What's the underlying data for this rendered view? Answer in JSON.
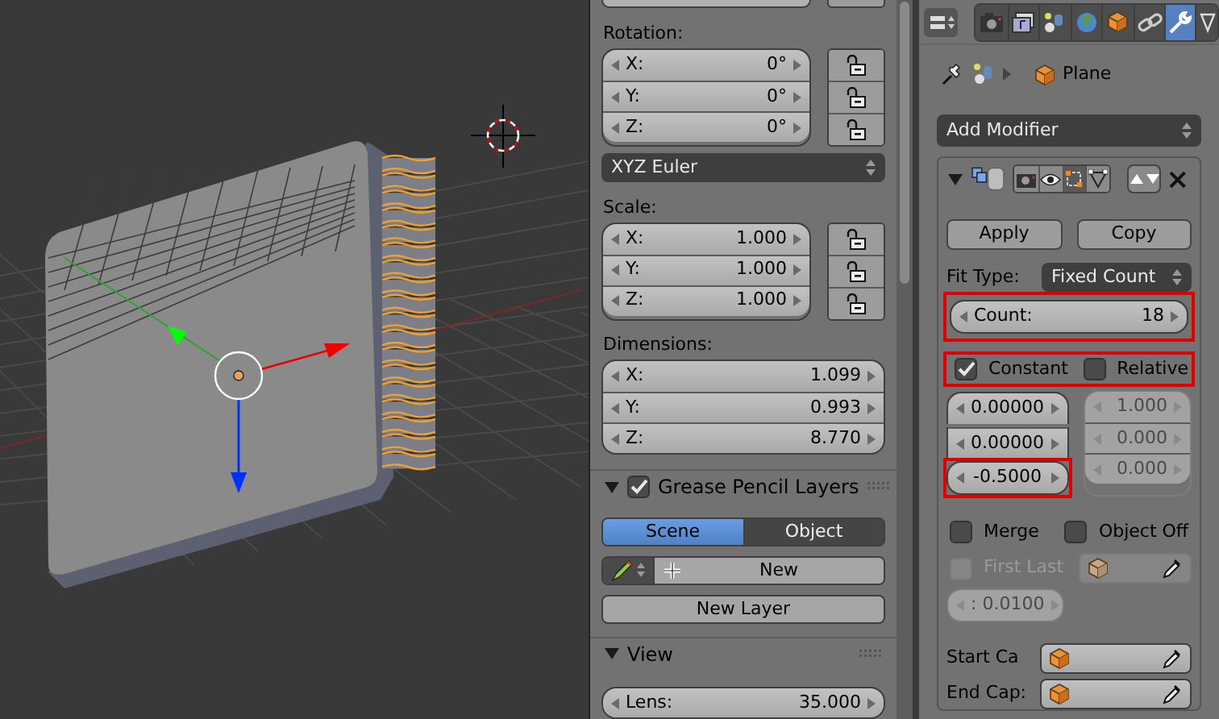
{
  "transform": {
    "rotation": {
      "label": "Rotation:",
      "fields": [
        {
          "axis": "X:",
          "value": "0°",
          "locked": false
        },
        {
          "axis": "Y:",
          "value": "0°",
          "locked": false
        },
        {
          "axis": "Z:",
          "value": "0°",
          "locked": false
        }
      ],
      "mode": "XYZ Euler"
    },
    "scale": {
      "label": "Scale:",
      "fields": [
        {
          "axis": "X:",
          "value": "1.000",
          "locked": false
        },
        {
          "axis": "Y:",
          "value": "1.000",
          "locked": false
        },
        {
          "axis": "Z:",
          "value": "1.000",
          "locked": false
        }
      ]
    },
    "dimensions": {
      "label": "Dimensions:",
      "fields": [
        {
          "axis": "X:",
          "value": "1.099"
        },
        {
          "axis": "Y:",
          "value": "0.993"
        },
        {
          "axis": "Z:",
          "value": "8.770"
        }
      ]
    }
  },
  "grease_pencil": {
    "title": "Grease Pencil Layers",
    "checked": true,
    "expanded": true,
    "tabs": [
      {
        "label": "Scene",
        "selected": true
      },
      {
        "label": "Object",
        "selected": false
      }
    ],
    "new_button": "New",
    "new_layer_button": "New Layer"
  },
  "view": {
    "title": "View",
    "expanded": true,
    "lens": {
      "label": "Lens:",
      "value": "35.000"
    }
  },
  "properties": {
    "tabs": [
      {
        "kind": "render",
        "selected": false
      },
      {
        "kind": "render_layers",
        "selected": false
      },
      {
        "kind": "scene",
        "selected": false
      },
      {
        "kind": "world",
        "selected": false
      },
      {
        "kind": "object",
        "selected": false
      },
      {
        "kind": "constraints",
        "selected": false
      },
      {
        "kind": "modifiers",
        "selected": true
      },
      {
        "kind": "data",
        "selected": false
      }
    ],
    "breadcrumb": {
      "object": "Plane"
    },
    "add_modifier": "Add Modifier",
    "modifier": {
      "expanded": true,
      "apply": "Apply",
      "copy": "Copy",
      "fit_type": {
        "label": "Fit Type:",
        "value": "Fixed Count"
      },
      "count": {
        "label": "Count:",
        "value": "18",
        "highlighted": true
      },
      "offset_modes": {
        "highlighted": true,
        "items": [
          {
            "label": "Constant",
            "checked": true
          },
          {
            "label": "Relative",
            "checked": false
          }
        ]
      },
      "constant_offsets": [
        {
          "value": "0.00000",
          "highlighted": false,
          "disabled": false
        },
        {
          "value": "0.00000",
          "highlighted": false,
          "disabled": false
        },
        {
          "value": "-0.5000",
          "highlighted": true,
          "disabled": false
        }
      ],
      "relative_offsets": [
        {
          "value": "1.000",
          "disabled": true
        },
        {
          "value": "0.000",
          "disabled": true
        },
        {
          "value": "0.000",
          "disabled": true
        }
      ],
      "merge": {
        "label": "Merge",
        "checked": false,
        "disabled": false
      },
      "object_offset": {
        "label": "Object Off",
        "checked": false,
        "disabled": false
      },
      "first_last": {
        "label": "First Last",
        "checked": false,
        "disabled": true
      },
      "merge_distance": {
        "value": ": 0.0100",
        "disabled": true
      },
      "start_cap": {
        "label": "Start Ca"
      },
      "end_cap": {
        "label": "End Cap:"
      }
    }
  }
}
